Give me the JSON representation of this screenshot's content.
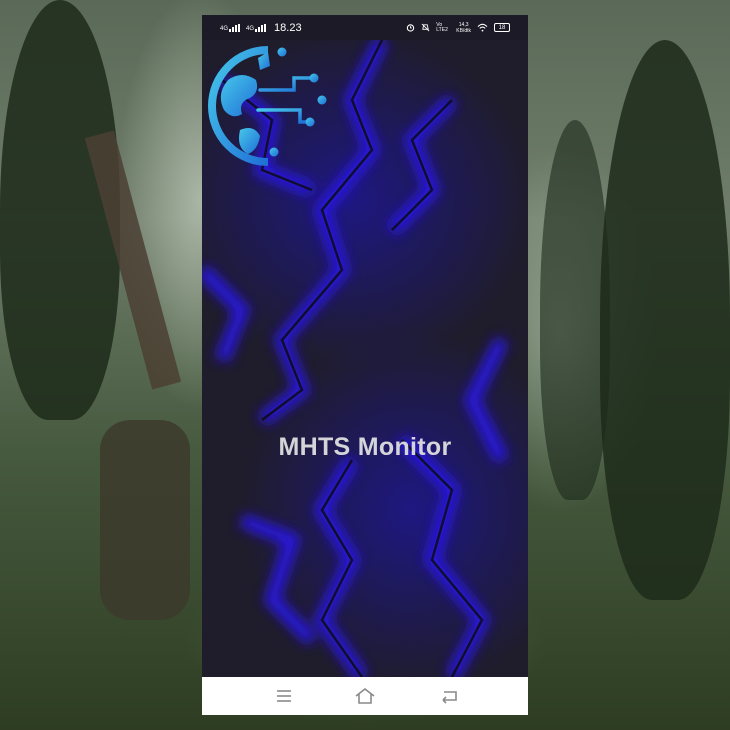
{
  "status_bar": {
    "net1": "4G",
    "net2": "4G",
    "time": "18.23",
    "lte": "Vo LTE2",
    "speed_value": "14,3",
    "speed_unit": "KB/dtk",
    "battery": "18",
    "icons": [
      "signal-icon",
      "signal-icon",
      "alarm-icon",
      "dnd-icon",
      "wifi-icon",
      "battery-icon"
    ]
  },
  "splash": {
    "title": "MHTS Monitor",
    "logo": "globe-circuit-logo",
    "background_colors": {
      "base": "#1f1c2c",
      "lightning": "#1a10e0"
    }
  },
  "nav_bar": {
    "icons": [
      "menu-icon",
      "home-icon",
      "back-icon"
    ]
  }
}
